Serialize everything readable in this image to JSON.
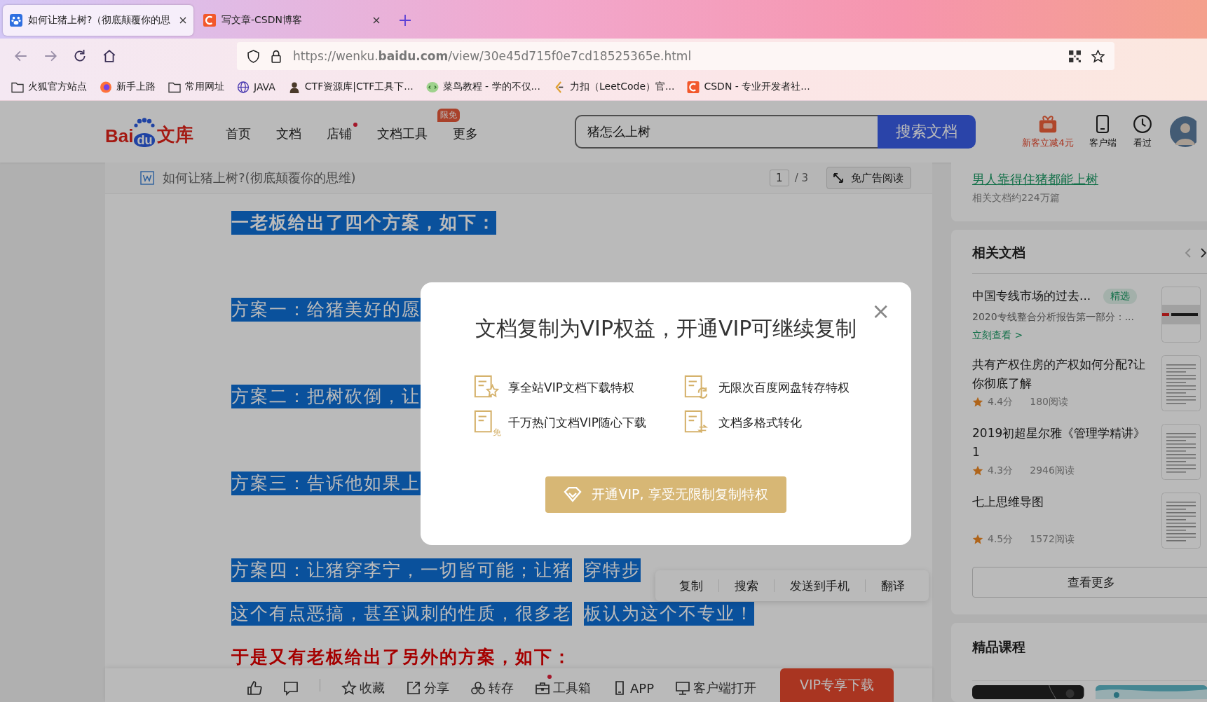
{
  "browser": {
    "tabs": [
      {
        "title": "如何让猪上树?（彻底颠覆你的思",
        "kind": "paw",
        "selected": true
      },
      {
        "title": "写文章-CSDN博客",
        "kind": "csdn",
        "selected": false
      }
    ],
    "url": "https://wenku.**baidu.com**/view/30e45d715f0e7cd18525365e.html",
    "bookmarks": [
      {
        "label": "火狐官方站点",
        "kind": "folder"
      },
      {
        "label": "新手上路",
        "kind": "firefox"
      },
      {
        "label": "常用网址",
        "kind": "folder"
      },
      {
        "label": "JAVA",
        "kind": "globe"
      },
      {
        "label": "CTF资源库|CTF工具下...",
        "kind": "person"
      },
      {
        "label": "菜鸟教程 - 学的不仅...",
        "kind": "runoob"
      },
      {
        "label": "力扣（LeetCode）官...",
        "kind": "leetcode"
      },
      {
        "label": "CSDN - 专业开发者社...",
        "kind": "csdn"
      }
    ]
  },
  "header": {
    "logo": {
      "part_1": "Bai",
      "part_2": "du",
      "part_3": "文库"
    },
    "nav": [
      {
        "label": "首页",
        "dot": false
      },
      {
        "label": "文档",
        "dot": false
      },
      {
        "label": "店铺",
        "dot": true
      },
      {
        "label": "文档工具",
        "dot": false,
        "badge": "限免"
      },
      {
        "label": "更多",
        "dot": false
      }
    ],
    "search": {
      "value": "猪怎么上树",
      "button": "搜索文档"
    },
    "actions": [
      {
        "label": "新客立减4元",
        "kind": "gift"
      },
      {
        "label": "客户端",
        "kind": "phone"
      },
      {
        "label": "看过",
        "kind": "clock"
      }
    ]
  },
  "document": {
    "title": "如何让猪上树?(彻底颠覆你的思维)",
    "page": "1",
    "page_total": "/ 3",
    "ad_free_button": "免广告阅读",
    "lines": [
      {
        "kind": "highlight",
        "parts": [
          "一老板给出了四个方案，如下："
        ]
      },
      {
        "kind": "highlight",
        "parts": [
          "方案一：给猪美好的愿"
        ]
      },
      {
        "kind": "highlight",
        "parts": [
          "方案二：把树砍倒，让"
        ]
      },
      {
        "kind": "highlight",
        "parts": [
          "方案三：告诉他如果上"
        ]
      },
      {
        "kind": "highlight",
        "parts": [
          "方案四：让猪穿李宁，一切皆可能；让猪",
          "穿特步"
        ]
      },
      {
        "kind": "highlight",
        "parts": [
          "这个有点恶搞，甚至讽刺的性质，很多老",
          "板认为这个不专业！"
        ]
      },
      {
        "kind": "red",
        "parts": [
          "于是又有老板给出了另外的方案，如下："
        ]
      }
    ]
  },
  "selection_menu": [
    "复制",
    "搜索",
    "发送到手机",
    "翻译"
  ],
  "toolbar": {
    "items": [
      {
        "kind": "like",
        "dot": false
      },
      {
        "kind": "comment",
        "dot": false
      },
      {
        "kind": "star",
        "label": "收藏",
        "dot": false
      },
      {
        "kind": "share",
        "label": "分享",
        "dot": false
      },
      {
        "kind": "save",
        "label": "转存",
        "dot": false
      },
      {
        "kind": "toolbox",
        "label": "工具箱",
        "dot": true
      },
      {
        "kind": "phone",
        "label": "APP",
        "dot": false
      },
      {
        "kind": "monitor",
        "label": "客户端打开",
        "dot": false
      }
    ],
    "download_button": "VIP专享下载"
  },
  "sidebar": {
    "topic": {
      "link": "男人靠得住猪都能上树",
      "count": "相关文档约224万篇"
    },
    "related": {
      "title": "相关文档",
      "items": [
        {
          "kind": "featured",
          "title": "中国专线市场的过去...",
          "tag": "精选",
          "desc": "2020专线整合分析报告第一部分：...",
          "link": "立刻查看 >"
        },
        {
          "kind": "rated",
          "title": "共有产权住房的产权如何分配?让你彻底了解",
          "score": "4.4分",
          "reads": "180阅读"
        },
        {
          "kind": "rated",
          "title": "2019初超星尔雅《管理学精讲》1",
          "score": "4.3分",
          "reads": "2946阅读"
        },
        {
          "kind": "rated",
          "title": "七上思维导图",
          "score": "4.5分",
          "reads": "1572阅读"
        }
      ],
      "more": "查看更多"
    },
    "courses": {
      "title": "精品课程"
    }
  },
  "modal": {
    "title": "文档复制为VIP权益，开通VIP可继续复制",
    "close": "×",
    "features": [
      {
        "label": "享全站VIP文档下载特权",
        "kind": "star"
      },
      {
        "label": "无限次百度网盘转存特权",
        "kind": "sync"
      },
      {
        "label": "千万热门文档VIP随心下载",
        "kind": "free",
        "badge": "免"
      },
      {
        "label": "文档多格式转化",
        "kind": "convert"
      }
    ],
    "button": "开通VIP, 享受无限制复制特权"
  }
}
